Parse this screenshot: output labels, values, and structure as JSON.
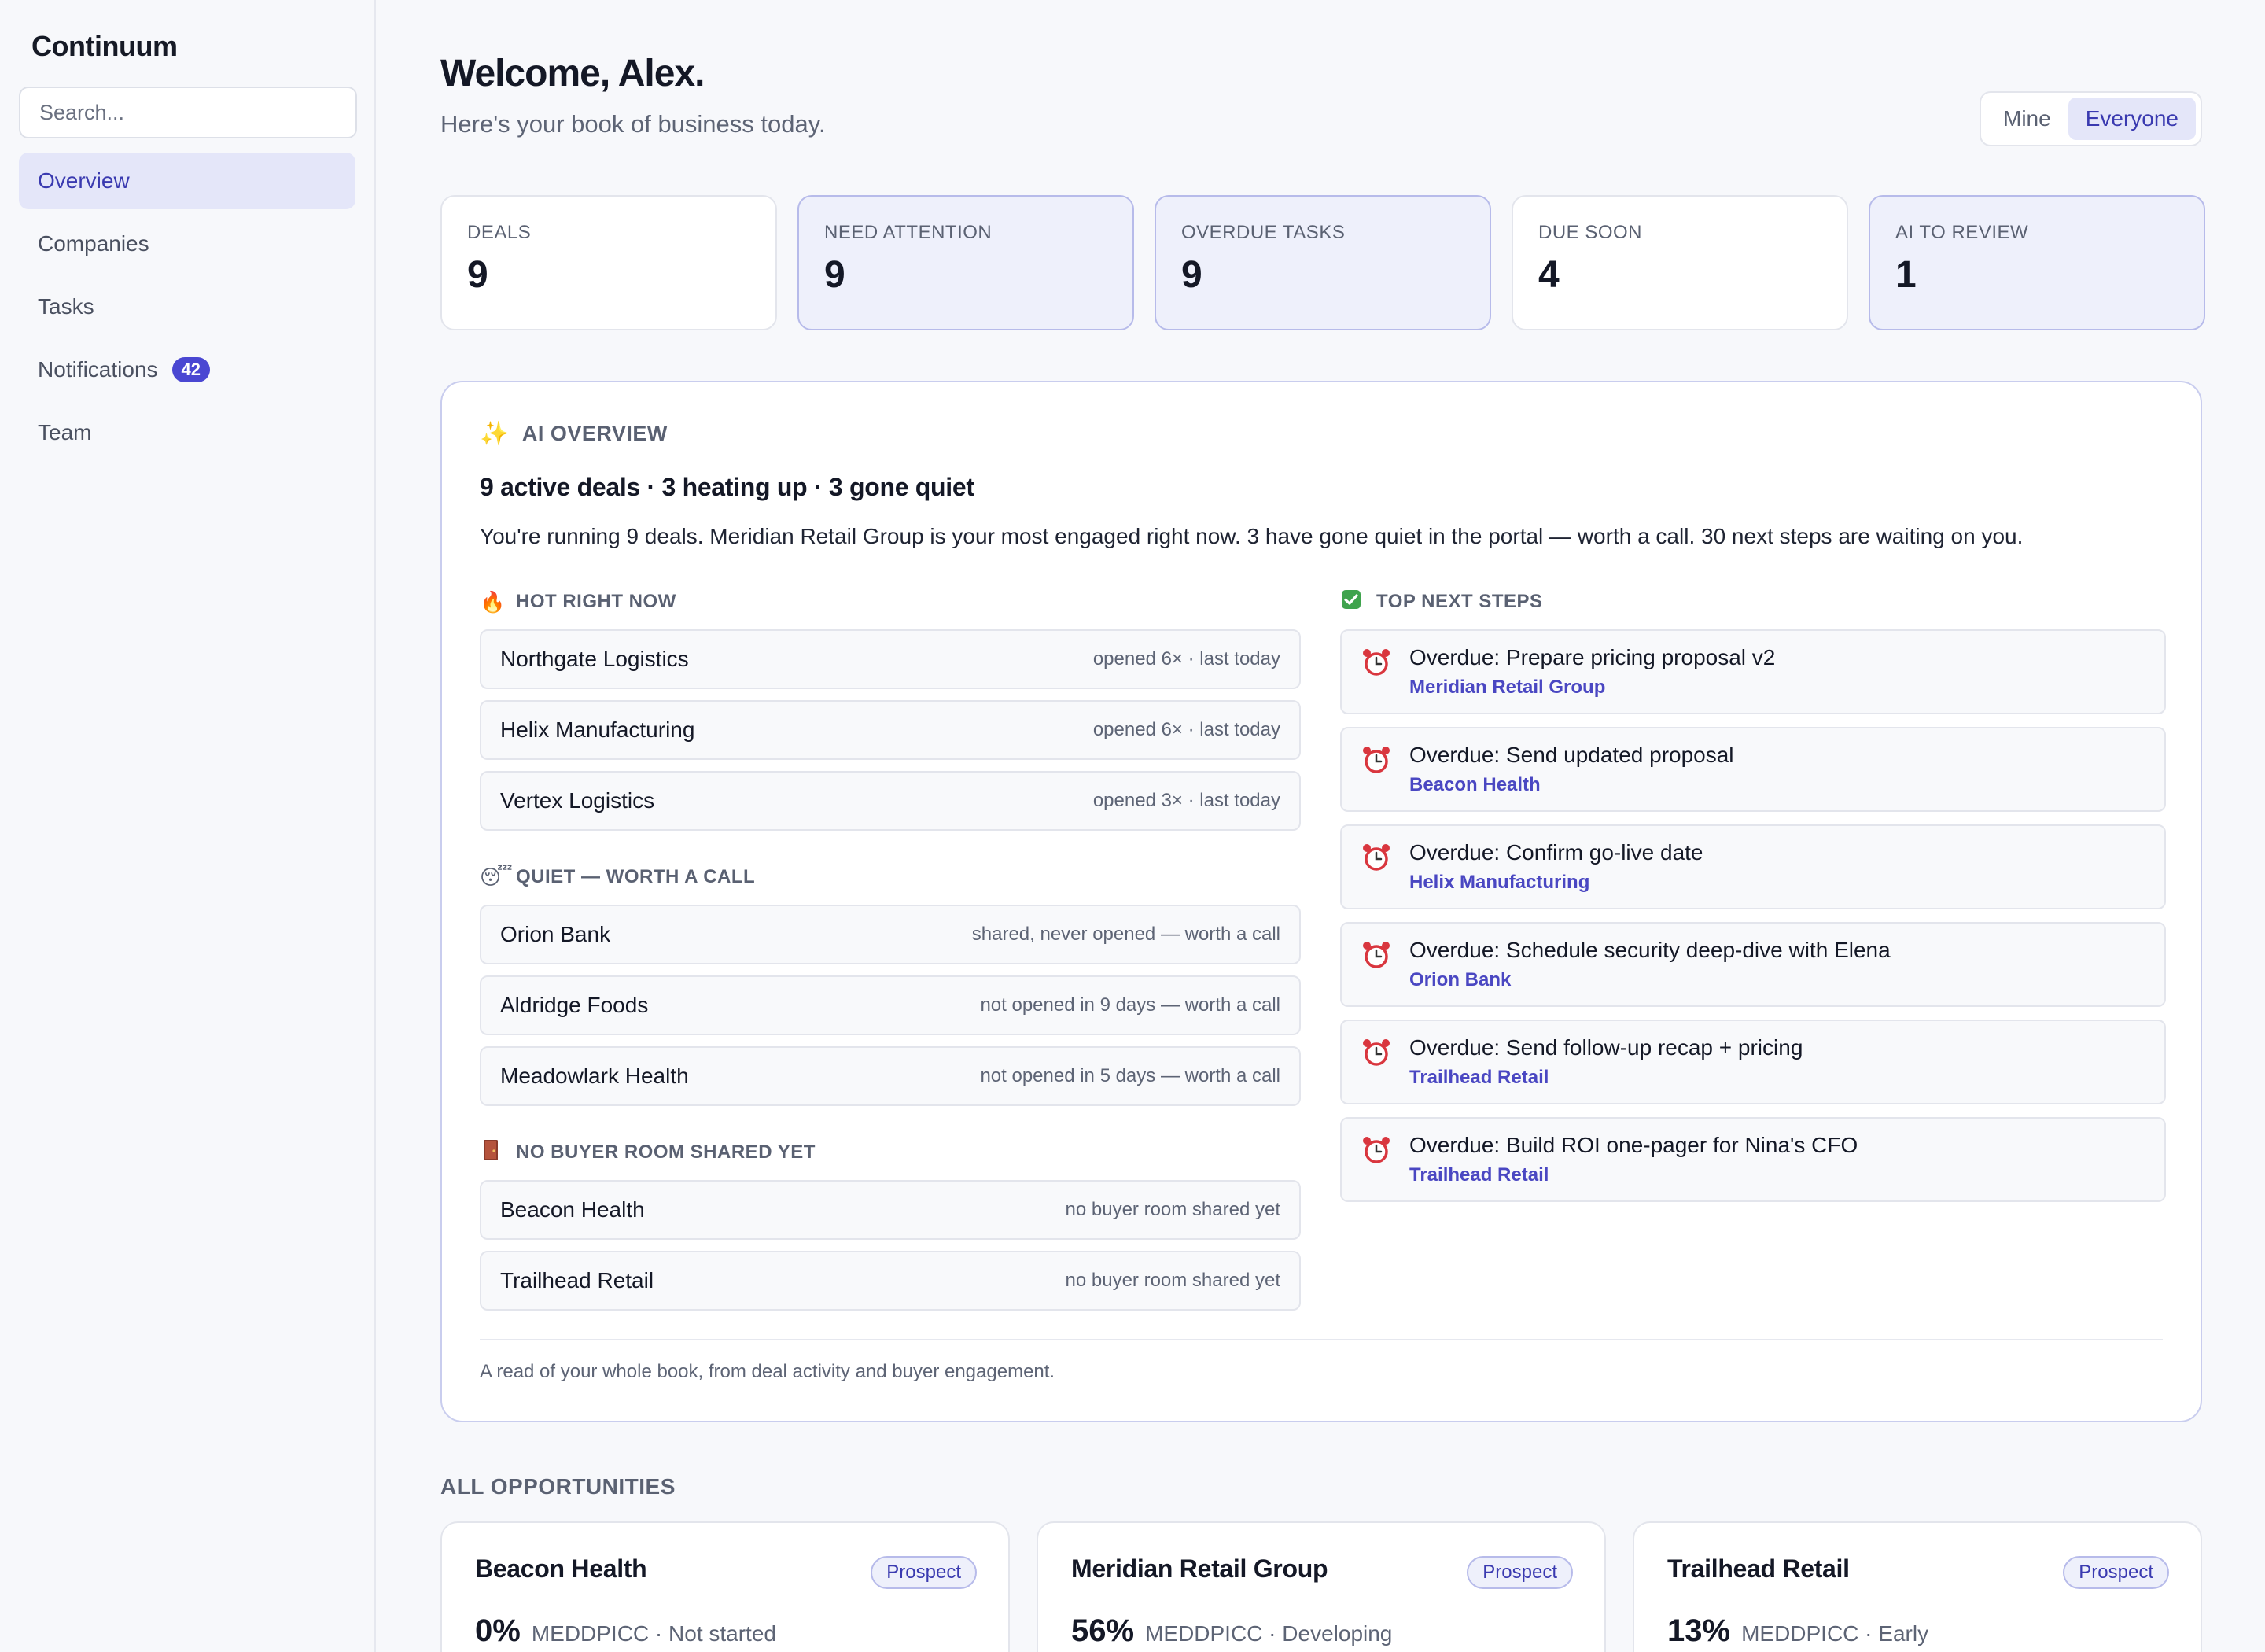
{
  "app": {
    "title": "Continuum"
  },
  "search": {
    "placeholder": "Search..."
  },
  "sidebar": {
    "items": [
      {
        "label": "Overview",
        "active": true
      },
      {
        "label": "Companies"
      },
      {
        "label": "Tasks"
      },
      {
        "label": "Notifications",
        "badge": "42"
      },
      {
        "label": "Team"
      }
    ]
  },
  "header": {
    "title": "Welcome, Alex.",
    "subtitle": "Here's your book of business today.",
    "toggle": {
      "options": [
        "Mine",
        "Everyone"
      ],
      "selected": "Everyone"
    }
  },
  "stats": [
    {
      "label": "DEALS",
      "value": "9",
      "highlight": false
    },
    {
      "label": "NEED ATTENTION",
      "value": "9",
      "highlight": true
    },
    {
      "label": "OVERDUE TASKS",
      "value": "9",
      "highlight": true
    },
    {
      "label": "DUE SOON",
      "value": "4",
      "highlight": false
    },
    {
      "label": "AI TO REVIEW",
      "value": "1",
      "highlight": true
    }
  ],
  "ai_overview": {
    "icon": "sparkles-icon",
    "heading": "AI OVERVIEW",
    "title": "9 active deals · 3 heating up · 3 gone quiet",
    "summary": "You're running 9 deals. Meridian Retail Group is your most engaged right now. 3 have gone quiet in the portal — worth a call. 30 next steps are waiting on you.",
    "hot": {
      "icon": "fire-icon",
      "heading": "HOT RIGHT NOW",
      "rows": [
        {
          "name": "Northgate Logistics",
          "meta": "opened 6× · last today"
        },
        {
          "name": "Helix Manufacturing",
          "meta": "opened 6× · last today"
        },
        {
          "name": "Vertex Logistics",
          "meta": "opened 3× · last today"
        }
      ]
    },
    "quiet": {
      "icon": "sleeping-face-icon",
      "heading": "QUIET — WORTH A CALL",
      "rows": [
        {
          "name": "Orion Bank",
          "meta": "shared, never opened — worth a call"
        },
        {
          "name": "Aldridge Foods",
          "meta": "not opened in 9 days — worth a call"
        },
        {
          "name": "Meadowlark Health",
          "meta": "not opened in 5 days — worth a call"
        }
      ]
    },
    "no_room": {
      "icon": "door-icon",
      "heading": "NO BUYER ROOM SHARED YET",
      "rows": [
        {
          "name": "Beacon Health",
          "meta": "no buyer room shared yet"
        },
        {
          "name": "Trailhead Retail",
          "meta": "no buyer room shared yet"
        }
      ]
    },
    "next_steps": {
      "icon": "check-box-icon",
      "heading": "TOP NEXT STEPS",
      "items": [
        {
          "title": "Overdue: Prepare pricing proposal v2",
          "company": "Meridian Retail Group"
        },
        {
          "title": "Overdue: Send updated proposal",
          "company": "Beacon Health"
        },
        {
          "title": "Overdue: Confirm go-live date",
          "company": "Helix Manufacturing"
        },
        {
          "title": "Overdue: Schedule security deep-dive with Elena",
          "company": "Orion Bank"
        },
        {
          "title": "Overdue: Send follow-up recap + pricing",
          "company": "Trailhead Retail"
        },
        {
          "title": "Overdue: Build ROI one-pager for Nina's CFO",
          "company": "Trailhead Retail"
        }
      ]
    },
    "footer": "A read of your whole book, from deal activity and buyer engagement."
  },
  "opportunities": {
    "heading": "ALL OPPORTUNITIES",
    "cards": [
      {
        "name": "Beacon Health",
        "stage": "Prospect",
        "pct": "0%",
        "meddpicc": "MEDDPICC · Not started"
      },
      {
        "name": "Meridian Retail Group",
        "stage": "Prospect",
        "pct": "56%",
        "meddpicc": "MEDDPICC · Developing"
      },
      {
        "name": "Trailhead Retail",
        "stage": "Prospect",
        "pct": "13%",
        "meddpicc": "MEDDPICC · Early"
      }
    ]
  },
  "colors": {
    "accent": "#4a47d2",
    "accent_soft": "#e4e6f9",
    "alarm": "#d9363e",
    "border_highlight": "#b7bbea"
  }
}
